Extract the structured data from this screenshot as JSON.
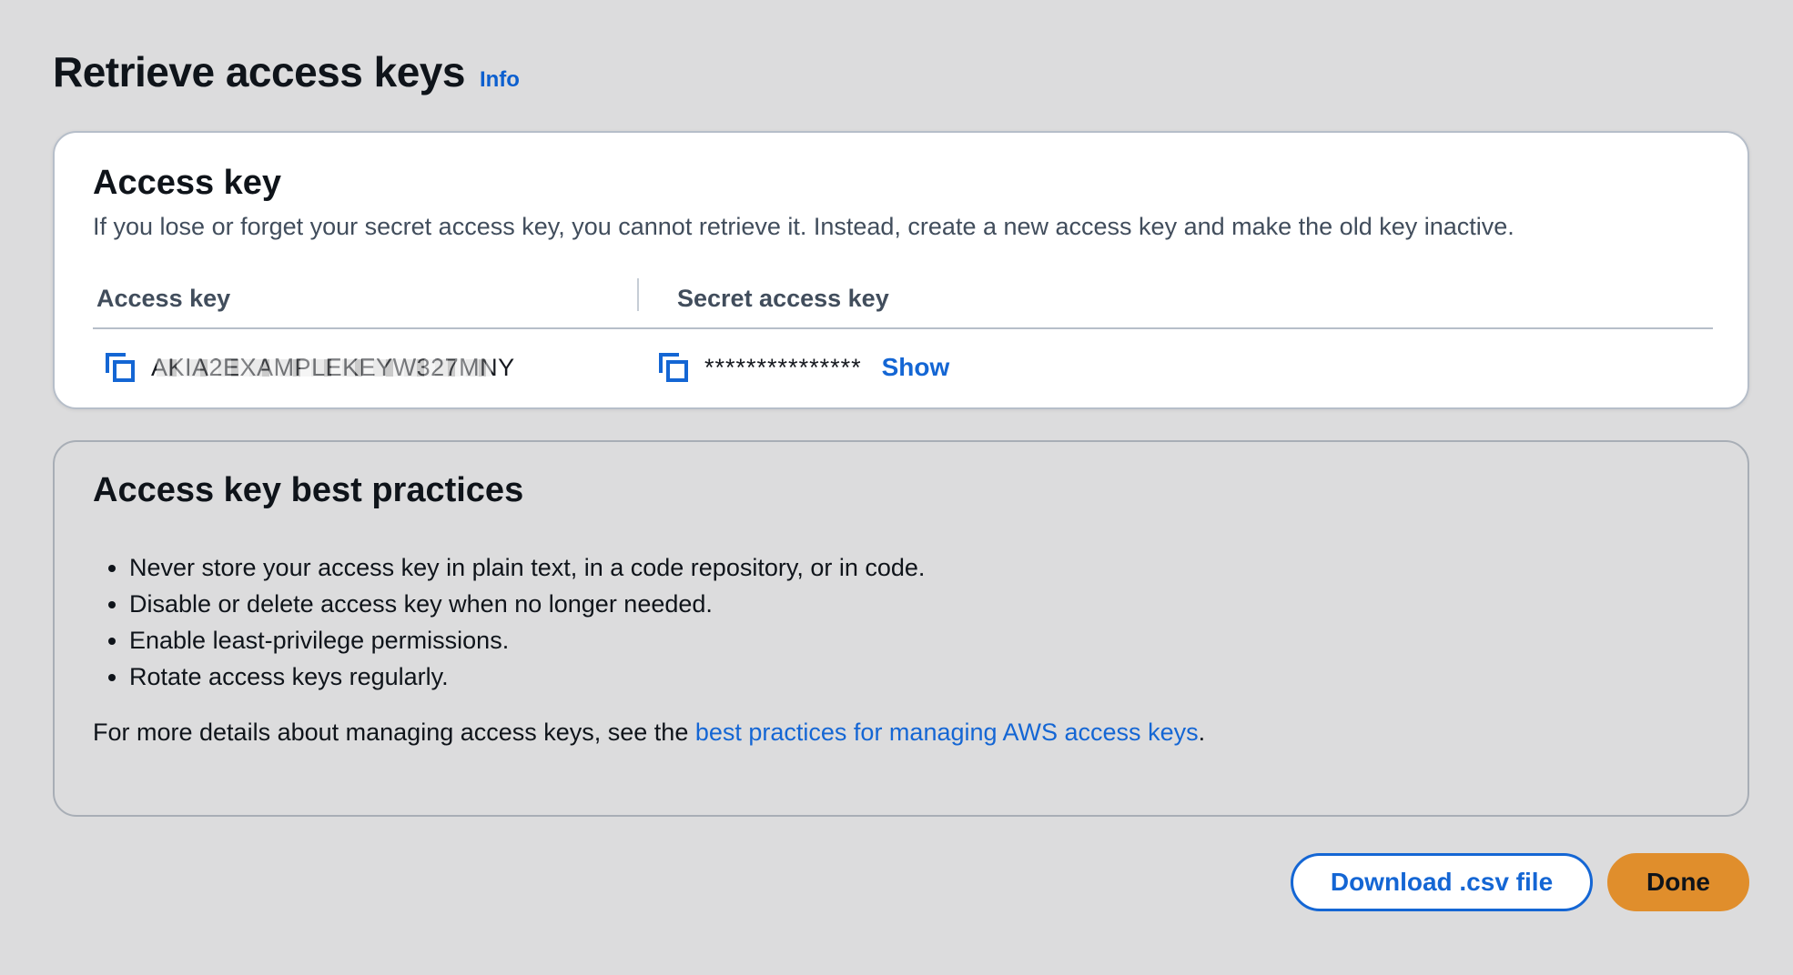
{
  "header": {
    "title": "Retrieve access keys",
    "info_label": "Info"
  },
  "access_key_panel": {
    "title": "Access key",
    "description": "If you lose or forget your secret access key, you cannot retrieve it. Instead, create a new access key and make the old key inactive.",
    "columns": [
      "Access key",
      "Secret access key"
    ],
    "access_key_value": "AKIA2EXAMPLEKEYW327MNY",
    "secret_value": "***************",
    "show_label": "Show",
    "icons": [
      "copy-icon",
      "copy-icon"
    ]
  },
  "best_practices_panel": {
    "title": "Access key best practices",
    "items": [
      "Never store your access key in plain text, in a code repository, or in code.",
      "Disable or delete access key when no longer needed.",
      "Enable least-privilege permissions.",
      "Rotate access keys regularly."
    ],
    "footer_prefix": "For more details about managing access keys, see the ",
    "footer_link": "best practices for managing AWS access keys",
    "footer_suffix": "."
  },
  "actions": {
    "download_label": "Download .csv file",
    "done_label": "Done"
  },
  "colors": {
    "background": "#dcdcdd",
    "link": "#1466d4",
    "primary_button": "#e08e2c"
  }
}
